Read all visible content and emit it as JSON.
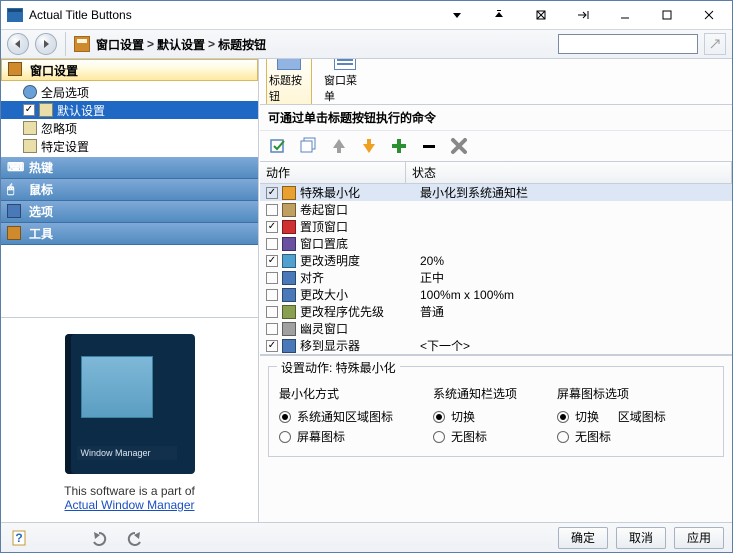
{
  "app": {
    "title": "Actual Title Buttons"
  },
  "breadcrumb": {
    "parts": [
      "窗口设置",
      "默认设置",
      "标题按钮"
    ]
  },
  "sidebar": {
    "sections": [
      {
        "label": "窗口设置"
      },
      {
        "label": "热键"
      },
      {
        "label": "鼠标"
      },
      {
        "label": "选项"
      },
      {
        "label": "工具"
      }
    ],
    "tree": [
      {
        "label": "全局选项",
        "checked": false
      },
      {
        "label": "默认设置",
        "checked": true,
        "selected": true
      },
      {
        "label": "忽略项",
        "checked": false
      },
      {
        "label": "特定设置",
        "checked": false
      }
    ]
  },
  "promo": {
    "text": "This software is a part of",
    "link": "Actual Window Manager"
  },
  "content": {
    "tabs": [
      {
        "label": "标题按钮"
      },
      {
        "label": "窗口菜单"
      }
    ],
    "section_title": "可通过单击标题按钮执行的命令",
    "columns": {
      "c1": "动作",
      "c2": "状态"
    },
    "rows": [
      {
        "checked": true,
        "label": "特殊最小化",
        "status": "最小化到系统通知栏",
        "selected": true
      },
      {
        "checked": false,
        "label": "卷起窗口",
        "status": ""
      },
      {
        "checked": true,
        "label": "置顶窗口",
        "status": ""
      },
      {
        "checked": false,
        "label": "窗口置底",
        "status": ""
      },
      {
        "checked": true,
        "label": "更改透明度",
        "status": "20%"
      },
      {
        "checked": false,
        "label": "对齐",
        "status": "正中"
      },
      {
        "checked": false,
        "label": "更改大小",
        "status": "100%m x 100%m"
      },
      {
        "checked": false,
        "label": "更改程序优先级",
        "status": "普通"
      },
      {
        "checked": false,
        "label": "幽灵窗口",
        "status": ""
      },
      {
        "checked": true,
        "label": "移到显示器",
        "status": "<下一个>"
      }
    ],
    "settings": {
      "legend_prefix": "设置动作: ",
      "legend_action": "特殊最小化",
      "group1": {
        "title": "最小化方式",
        "opts": [
          "系统通知区域图标",
          "屏幕图标"
        ],
        "selected": 0
      },
      "group2": {
        "title": "系统通知栏选项",
        "opts": [
          "切换",
          "无图标"
        ],
        "selected": 0
      },
      "group3": {
        "title": "屏幕图标选项",
        "opts": [
          "切换",
          "无图标"
        ],
        "selected": 0,
        "extra_label": "区域图标"
      }
    }
  },
  "bottom": {
    "ok": "确定",
    "cancel": "取消",
    "apply": "应用"
  }
}
